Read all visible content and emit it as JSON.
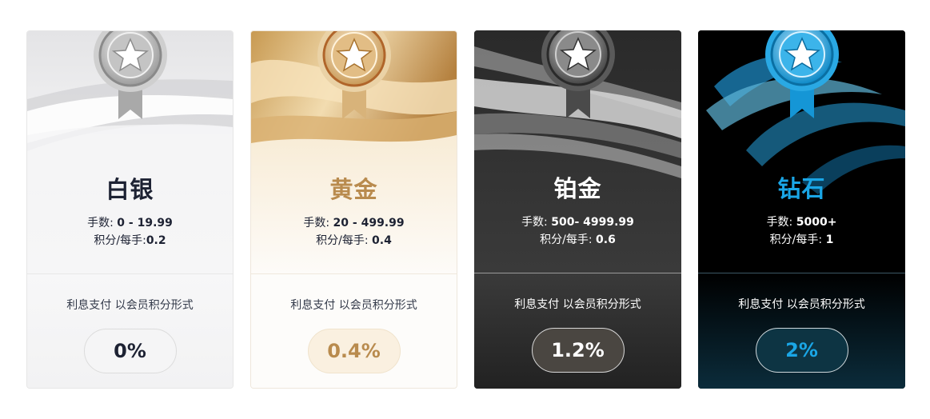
{
  "tiers": [
    {
      "name": "白银",
      "lots_label": "手数: ",
      "lots_value": "0 - 19.99",
      "points_label": "积分/每手:",
      "points_value": "0.2",
      "interest_text": "利息支付 以会员积分形式",
      "rate": "0%",
      "accent": "#1d2233"
    },
    {
      "name": "黄金",
      "lots_label": "手数: ",
      "lots_value": "20 - 499.99",
      "points_label": "积分/每手: ",
      "points_value": "0.4",
      "interest_text": "利息支付 以会员积分形式",
      "rate": "0.4%",
      "accent": "#b98b4e"
    },
    {
      "name": "铂金",
      "lots_label": "手数: ",
      "lots_value": "500- 4999.99",
      "points_label": "积分/每手: ",
      "points_value": "0.6",
      "interest_text": "利息支付 以会员积分形式",
      "rate": "1.2%",
      "accent": "#ffffff"
    },
    {
      "name": "钻石",
      "lots_label": "手数: ",
      "lots_value": "5000+",
      "points_label": "积分/每手: ",
      "points_value": "1",
      "interest_text": "利息支付 以会员积分形式",
      "rate": "2%",
      "accent": "#1aa6e6"
    }
  ],
  "icons": {
    "medal": "star-medal-icon"
  }
}
